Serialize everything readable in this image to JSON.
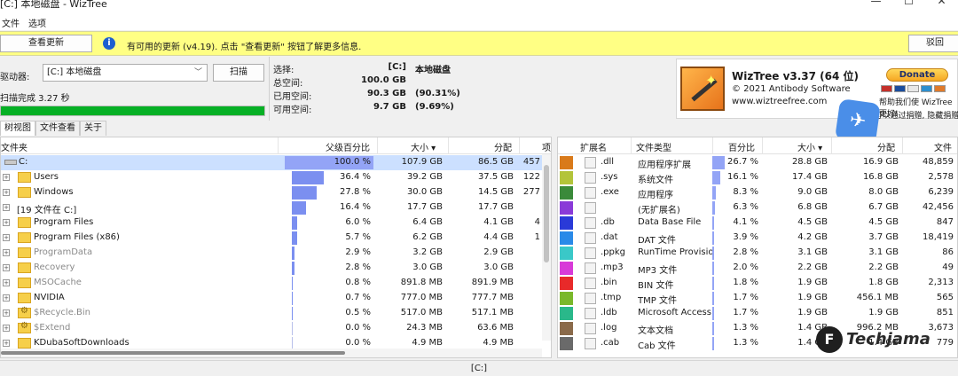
{
  "window": {
    "title": "[C:] 本地磁盘  - WizTree",
    "controls": [
      "—",
      "☐",
      "✕"
    ]
  },
  "menu": [
    "文件",
    "选项"
  ],
  "update": {
    "check_label": "查看更新",
    "message": "有可用的更新 (v4.19). 点击 \"查看更新\" 按钮了解更多信息.",
    "return_label": "驳回"
  },
  "scan": {
    "drive_label": "驱动器:",
    "drive_value": "[C:] 本地磁盘",
    "scan_label": "扫描",
    "done": "扫描完成 3.27 秒",
    "progress": 1.0
  },
  "stats": [
    {
      "label": "选择:",
      "v1": "[C:]",
      "v2": "本地磁盘"
    },
    {
      "label": "总空间:",
      "v1": "100.0 GB",
      "v2": ""
    },
    {
      "label": "已用空间:",
      "v1": "90.3 GB",
      "v2": "(90.31%)"
    },
    {
      "label": "可用空间:",
      "v1": "9.7 GB",
      "v2": "(9.69%)"
    }
  ],
  "brand": {
    "name": "WizTree v3.37 (64 位)",
    "copyright": "© 2021 Antibody Software",
    "site": "www.wiztreefree.com",
    "donate": "Donate",
    "help": "帮助我们使 WizTree 更好!",
    "sub": "(您可以通过捐赠, 隐藏捐赠按钮)"
  },
  "tabs": [
    "树视图",
    "文件查看",
    "关于"
  ],
  "tree": {
    "headers": {
      "name": "文件夹",
      "pct": "父级百分比",
      "size": "大小",
      "alloc": "分配",
      "items": "项目"
    },
    "rows": [
      {
        "name": "C:",
        "pct": 100.0,
        "pct_text": "100.0 %",
        "size": "107.9 GB",
        "alloc": "86.5 GB",
        "items": "457",
        "kind": "drive",
        "grey": false
      },
      {
        "name": "Users",
        "pct": 36.4,
        "pct_text": "36.4 %",
        "size": "39.2 GB",
        "alloc": "37.5 GB",
        "items": "122",
        "kind": "folder",
        "grey": false
      },
      {
        "name": "Windows",
        "pct": 27.8,
        "pct_text": "27.8 %",
        "size": "30.0 GB",
        "alloc": "14.5 GB",
        "items": "277",
        "kind": "folder",
        "grey": false
      },
      {
        "name": "[19 文件在 C:]",
        "pct": 16.4,
        "pct_text": "16.4 %",
        "size": "17.7 GB",
        "alloc": "17.7 GB",
        "items": "",
        "kind": "files",
        "grey": false
      },
      {
        "name": "Program Files",
        "pct": 6.0,
        "pct_text": "6.0 %",
        "size": "6.4 GB",
        "alloc": "4.1 GB",
        "items": "4",
        "kind": "folder",
        "grey": false
      },
      {
        "name": "Program Files (x86)",
        "pct": 5.7,
        "pct_text": "5.7 %",
        "size": "6.2 GB",
        "alloc": "4.4 GB",
        "items": "1",
        "kind": "folder",
        "grey": false
      },
      {
        "name": "ProgramData",
        "pct": 2.9,
        "pct_text": "2.9 %",
        "size": "3.2 GB",
        "alloc": "2.9 GB",
        "items": "",
        "kind": "folder",
        "grey": true
      },
      {
        "name": "Recovery",
        "pct": 2.8,
        "pct_text": "2.8 %",
        "size": "3.0 GB",
        "alloc": "3.0 GB",
        "items": "",
        "kind": "folder",
        "grey": true
      },
      {
        "name": "MSOCache",
        "pct": 0.8,
        "pct_text": "0.8 %",
        "size": "891.8 MB",
        "alloc": "891.9 MB",
        "items": "",
        "kind": "folder",
        "grey": true
      },
      {
        "name": "NVIDIA",
        "pct": 0.7,
        "pct_text": "0.7 %",
        "size": "777.0 MB",
        "alloc": "777.7 MB",
        "items": "",
        "kind": "folder",
        "grey": false
      },
      {
        "name": "$Recycle.Bin",
        "pct": 0.5,
        "pct_text": "0.5 %",
        "size": "517.0 MB",
        "alloc": "517.1 MB",
        "items": "",
        "kind": "gear",
        "grey": true
      },
      {
        "name": "$Extend",
        "pct": 0.0,
        "pct_text": "0.0 %",
        "size": "24.3 MB",
        "alloc": "63.6 MB",
        "items": "",
        "kind": "gear",
        "grey": true
      },
      {
        "name": "KDubaSoftDownloads",
        "pct": 0.0,
        "pct_text": "0.0 %",
        "size": "4.9 MB",
        "alloc": "4.9 MB",
        "items": "",
        "kind": "folder",
        "grey": false
      }
    ]
  },
  "ext": {
    "headers": {
      "ext": "扩展名",
      "type": "文件类型",
      "pct": "百分比",
      "size": "大小",
      "alloc": "分配",
      "files": "文件"
    },
    "rows": [
      {
        "color": "#d97a1a",
        "ext": ".dll",
        "type": "应用程序扩展",
        "pct": 26.7,
        "pct_text": "26.7 %",
        "size": "28.8 GB",
        "alloc": "16.9 GB",
        "files": "48,859"
      },
      {
        "color": "#b3c43a",
        "ext": ".sys",
        "type": "系统文件",
        "pct": 16.1,
        "pct_text": "16.1 %",
        "size": "17.4 GB",
        "alloc": "16.8 GB",
        "files": "2,578"
      },
      {
        "color": "#3a8a3a",
        "ext": ".exe",
        "type": "应用程序",
        "pct": 8.3,
        "pct_text": "8.3 %",
        "size": "9.0 GB",
        "alloc": "8.0 GB",
        "files": "6,239"
      },
      {
        "color": "#8a3ad8",
        "ext": "",
        "type": "(无扩展名)",
        "pct": 6.3,
        "pct_text": "6.3 %",
        "size": "6.8 GB",
        "alloc": "6.7 GB",
        "files": "42,456"
      },
      {
        "color": "#2a3ad8",
        "ext": ".db",
        "type": "Data Base File",
        "pct": 4.1,
        "pct_text": "4.1 %",
        "size": "4.5 GB",
        "alloc": "4.5 GB",
        "files": "847"
      },
      {
        "color": "#2a8ae8",
        "ext": ".dat",
        "type": "DAT 文件",
        "pct": 3.9,
        "pct_text": "3.9 %",
        "size": "4.2 GB",
        "alloc": "3.7 GB",
        "files": "18,419"
      },
      {
        "color": "#3ac8c8",
        "ext": ".ppkg",
        "type": "RunTime Provision",
        "pct": 2.8,
        "pct_text": "2.8 %",
        "size": "3.1 GB",
        "alloc": "3.1 GB",
        "files": "86"
      },
      {
        "color": "#d83ad8",
        "ext": ".mp3",
        "type": "MP3 文件",
        "pct": 2.0,
        "pct_text": "2.0 %",
        "size": "2.2 GB",
        "alloc": "2.2 GB",
        "files": "49"
      },
      {
        "color": "#e82a2a",
        "ext": ".bin",
        "type": "BIN 文件",
        "pct": 1.8,
        "pct_text": "1.8 %",
        "size": "1.9 GB",
        "alloc": "1.8 GB",
        "files": "2,313"
      },
      {
        "color": "#7ab82a",
        "ext": ".tmp",
        "type": "TMP 文件",
        "pct": 1.7,
        "pct_text": "1.7 %",
        "size": "1.9 GB",
        "alloc": "456.1 MB",
        "files": "565"
      },
      {
        "color": "#2ab88a",
        "ext": ".ldb",
        "type": "Microsoft Access R",
        "pct": 1.7,
        "pct_text": "1.7 %",
        "size": "1.9 GB",
        "alloc": "1.9 GB",
        "files": "851"
      },
      {
        "color": "#8a6a4a",
        "ext": ".log",
        "type": "文本文档",
        "pct": 1.3,
        "pct_text": "1.3 %",
        "size": "1.4 GB",
        "alloc": "996.2 MB",
        "files": "3,673"
      },
      {
        "color": "#6a6a6a",
        "ext": ".cab",
        "type": "Cab 文件",
        "pct": 1.3,
        "pct_text": "1.3 %",
        "size": "1.4 GB",
        "alloc": "1.4 GB",
        "files": "779"
      }
    ]
  },
  "statusbar": "[C:]",
  "watermark": {
    "letter": "F",
    "text": "Techjama"
  }
}
